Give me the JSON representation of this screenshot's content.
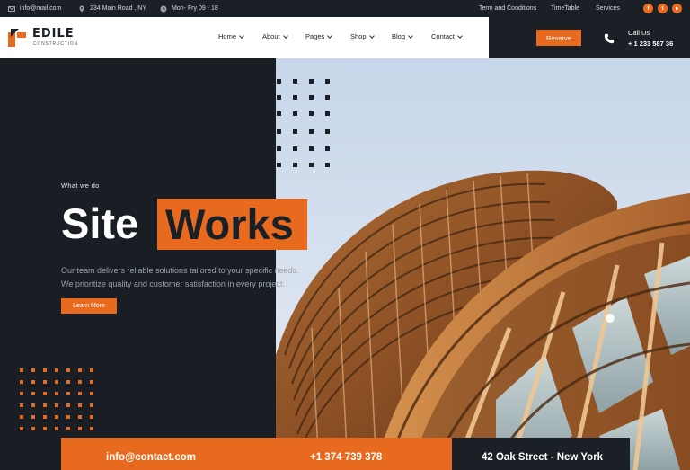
{
  "topbar": {
    "email": "info@mail.com",
    "address": "234 Main Road , NY",
    "hours": "Mon- Fry 09 - 18",
    "links": [
      "Term and Conditions",
      "TimeTable",
      "Services"
    ],
    "social_icons": [
      "facebook-icon",
      "twitter-icon",
      "youtube-icon"
    ]
  },
  "header": {
    "logo_name": "EDILE",
    "logo_sub": "CONSTRUCTION",
    "nav": [
      "Home",
      "About",
      "Pages",
      "Shop",
      "Blog",
      "Contact"
    ],
    "reserve_label": "Reserve",
    "call_label": "Call Us",
    "call_number": "+ 1 233 587 36"
  },
  "hero": {
    "eyebrow": "What we do",
    "title_part1": "Site",
    "title_part2": "Works",
    "description_line1": "Our team delivers reliable solutions tailored to your specific needs.",
    "description_line2": "We prioritize quality and customer satisfaction in every project.",
    "cta_label": "Learn More"
  },
  "contact_strip": {
    "email": "info@contact.com",
    "phone": "+1 374 739 378",
    "address": "42 Oak Street - New York"
  },
  "colors": {
    "accent": "#e86a1f",
    "dark": "#191e25",
    "white": "#ffffff"
  }
}
